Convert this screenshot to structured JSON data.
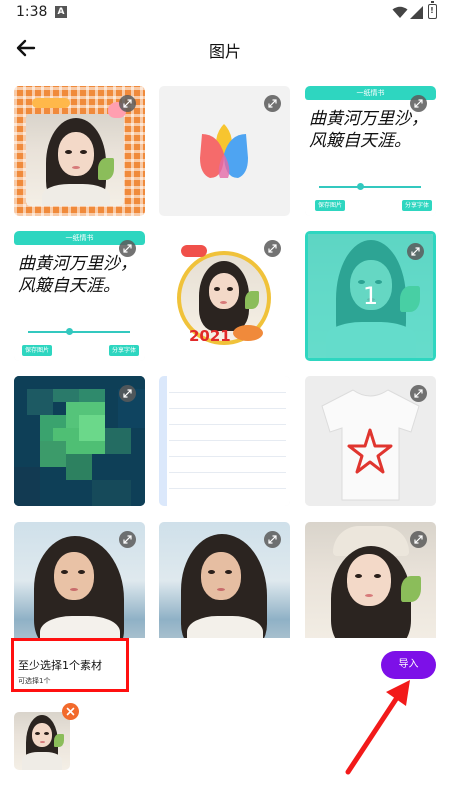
{
  "status_bar": {
    "time": "1:38",
    "notification_icon": "A",
    "wifi_icon": "wifi-icon",
    "signal_icon": "signal-icon",
    "battery_icon": "battery-icon"
  },
  "header": {
    "title": "图片",
    "back_icon": "back-arrow-icon"
  },
  "grid": {
    "items": [
      {
        "type": "framed-portrait",
        "expand_icon": "expand-icon"
      },
      {
        "type": "app-logo",
        "expand_icon": "expand-icon"
      },
      {
        "type": "calligraphy-card",
        "header_text": "一纸情书",
        "body_line1": "曲黄河万里沙，",
        "body_line2": "风簸自天涯。",
        "btn_save": "保存图片",
        "btn_share": "分享字体",
        "expand_icon": "expand-icon"
      },
      {
        "type": "calligraphy-card",
        "header_text": "一纸情书",
        "body_line1": "曲黄河万里沙，",
        "body_line2": "风簸自天涯。",
        "btn_save": "保存图片",
        "btn_share": "分享字体",
        "expand_icon": "expand-icon"
      },
      {
        "type": "sticker-portrait",
        "badge_text": "2021",
        "expand_icon": "expand-icon"
      },
      {
        "type": "selected-portrait",
        "selection_number": "1",
        "expand_icon": "expand-icon"
      },
      {
        "type": "pixelated",
        "expand_icon": "expand-icon"
      },
      {
        "type": "lined-paper"
      },
      {
        "type": "tshirt-star",
        "expand_icon": "expand-icon"
      },
      {
        "type": "beach-portrait",
        "expand_icon": "expand-icon"
      },
      {
        "type": "beach-portrait",
        "expand_icon": "expand-icon"
      },
      {
        "type": "hat-portrait",
        "expand_icon": "expand-icon"
      }
    ]
  },
  "selection": {
    "hint_main": "至少选择1个素材",
    "hint_sub": "可选择1个",
    "import_label": "导入",
    "remove_icon": "close-icon"
  },
  "colors": {
    "accent_teal": "#2ed6c0",
    "import_purple": "#7d10e8",
    "highlight_red": "#ff1010",
    "remove_orange": "#f26a2c"
  }
}
